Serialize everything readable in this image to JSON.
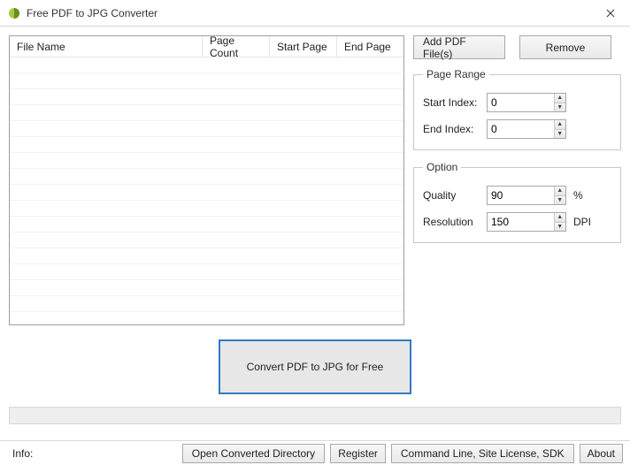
{
  "window": {
    "title": "Free PDF to JPG Converter"
  },
  "table": {
    "columns": {
      "file_name": "File Name",
      "page_count": "Page Count",
      "start_page": "Start Page",
      "end_page": "End Page"
    }
  },
  "buttons": {
    "add": "Add PDF File(s)",
    "remove": "Remove",
    "convert": "Convert PDF to JPG for Free",
    "open_dir": "Open Converted Directory",
    "register": "Register",
    "cmdline": "Command Line, Site License, SDK",
    "about": "About"
  },
  "page_range": {
    "legend": "Page Range",
    "start_label": "Start Index:",
    "start_value": "0",
    "end_label": "End Index:",
    "end_value": "0"
  },
  "option": {
    "legend": "Option",
    "quality_label": "Quality",
    "quality_value": "90",
    "quality_unit": "%",
    "resolution_label": "Resolution",
    "resolution_value": "150",
    "resolution_unit": "DPI"
  },
  "footer": {
    "info": "Info:"
  }
}
